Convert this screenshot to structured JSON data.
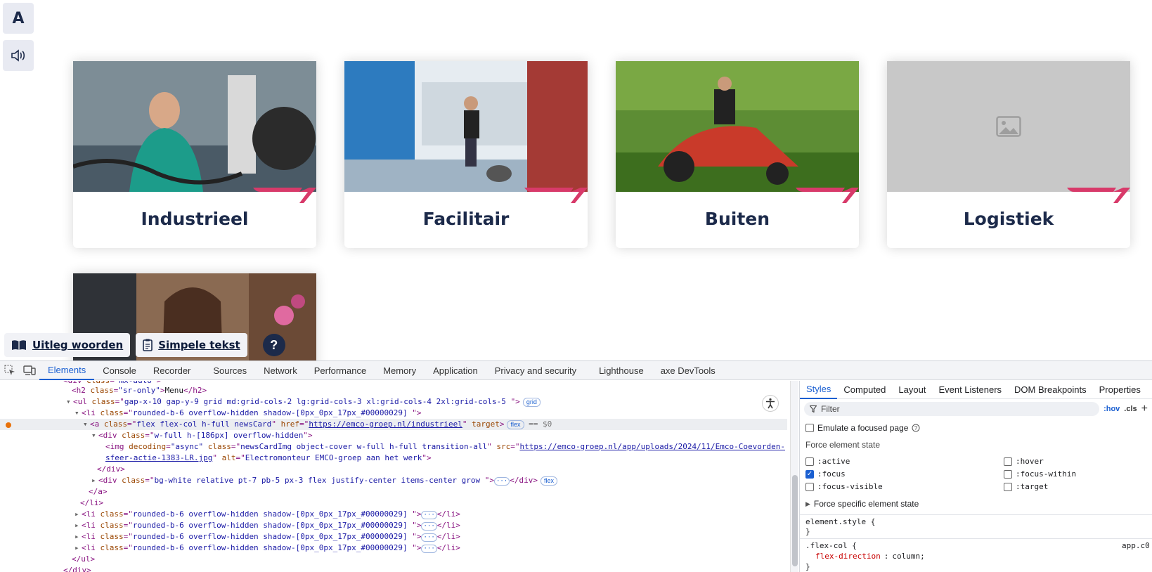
{
  "sidebar": {
    "text_size_label": "A"
  },
  "cards": [
    {
      "title": "Industrieel"
    },
    {
      "title": "Facilitair"
    },
    {
      "title": "Buiten"
    },
    {
      "title": "Logistiek"
    }
  ],
  "bottom_bar": {
    "uitleg_label": "Uitleg woorden",
    "simpele_label": "Simpele tekst",
    "help_label": "?"
  },
  "devtools": {
    "tabs": [
      "Elements",
      "Console",
      "Recorder",
      "Sources",
      "Network",
      "Performance",
      "Memory",
      "Application",
      "Privacy and security",
      "Lighthouse",
      "axe DevTools"
    ],
    "lines": {
      "l0": "<div class=\"mx-auto\">",
      "h2_text": "Menu",
      "ul_class": "gap-x-10 gap-y-9  grid md:grid-cols-2 lg:grid-cols-3 xl:grid-cols-4 2xl:grid-cols-5  ",
      "li_class": "rounded-b-6 overflow-hidden  shadow-[0px_0px_17px_#00000029]  ",
      "a_class": "flex flex-col h-full newsCard",
      "a_href": "https://emco-groep.nl/industrieel",
      "div_class": "w-full h-[186px] overflow-hidden",
      "img_class": "newsCardImg object-cover w-full h-full transition-all",
      "img_src_1": "https://emco-groep.nl/app/uploads/2024/11/Emco-Coevorden-",
      "img_src_2": "sfeer-actie-1383-LR.jpg",
      "img_alt": "Electromonteur EMCO-groep aan het werk",
      "div2_class": "bg-white relative pt-7 pb-5 px-3 flex justify-center items-center grow ",
      "badge_grid": "grid",
      "badge_flex": "flex",
      "dollar": "== $0"
    },
    "styles_tabs": [
      "Styles",
      "Computed",
      "Layout",
      "Event Listeners",
      "DOM Breakpoints",
      "Properties"
    ],
    "filter_placeholder": "Filter",
    "hov": ":hov",
    "cls": ".cls",
    "emulate_label": "Emulate a focused page",
    "force_state_label": "Force element state",
    "states": [
      ":active",
      ":hover",
      ":focus",
      ":focus-within",
      ":focus-visible",
      ":target"
    ],
    "force_specific_label": "Force specific element state",
    "element_style": "element.style {",
    "close_brace": "}",
    "flex_col_rule": ".flex-col {",
    "flex_col_prop": "flex-direction",
    "flex_col_val": "column;",
    "source_file": "app.c0"
  }
}
